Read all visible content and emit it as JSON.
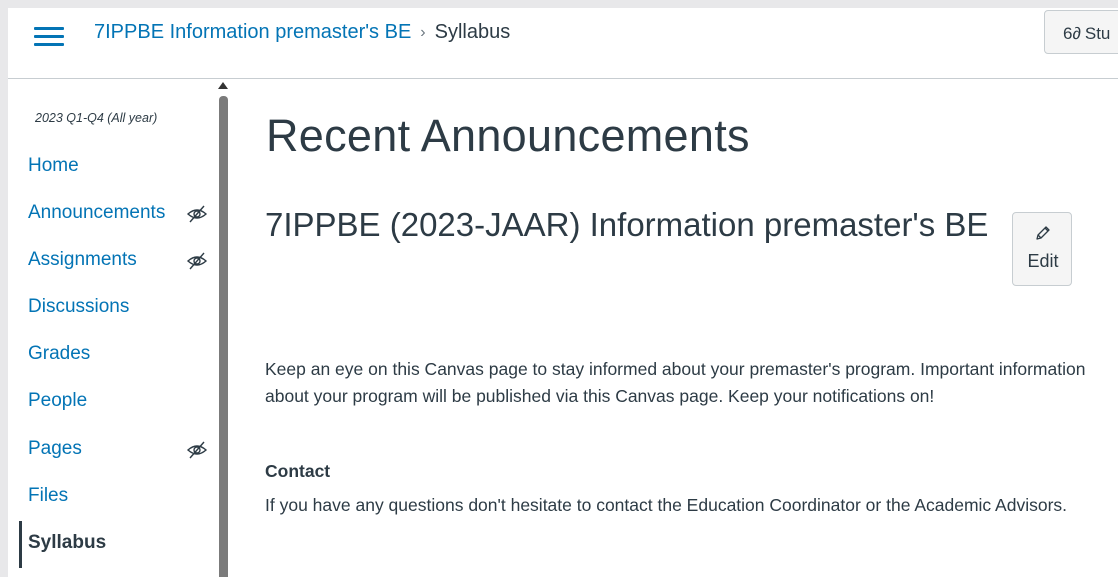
{
  "header": {
    "breadcrumb_course": "7IPPBE Information premaster's BE",
    "breadcrumb_separator": "›",
    "breadcrumb_current": "Syllabus",
    "student_view_label": "Stu",
    "student_view_icon": "6∂"
  },
  "sidebar": {
    "term": "2023 Q1-Q4 (All year)",
    "items": [
      {
        "label": "Home",
        "hidden": false,
        "active": false
      },
      {
        "label": "Announcements",
        "hidden": true,
        "active": false
      },
      {
        "label": "Assignments",
        "hidden": true,
        "active": false
      },
      {
        "label": "Discussions",
        "hidden": false,
        "active": false
      },
      {
        "label": "Grades",
        "hidden": false,
        "active": false
      },
      {
        "label": "People",
        "hidden": false,
        "active": false
      },
      {
        "label": "Pages",
        "hidden": true,
        "active": false
      },
      {
        "label": "Files",
        "hidden": false,
        "active": false
      },
      {
        "label": "Syllabus",
        "hidden": false,
        "active": true
      }
    ]
  },
  "main": {
    "page_title": "Recent Announcements",
    "course_title": "7IPPBE (2023-JAAR) Information premaster's BE",
    "edit_label": "Edit",
    "intro_text": "Keep an eye on this Canvas page to stay informed about your premaster's program. Important information about your program will be published via this Canvas page. Keep your notifications on!",
    "contact_heading": "Contact",
    "contact_text": "If you have any questions don't hesitate to contact the Education Coordinator or the Academic Advisors."
  },
  "colors": {
    "link": "#0374b5",
    "text": "#2d3b45",
    "border": "#c7cdd1"
  }
}
